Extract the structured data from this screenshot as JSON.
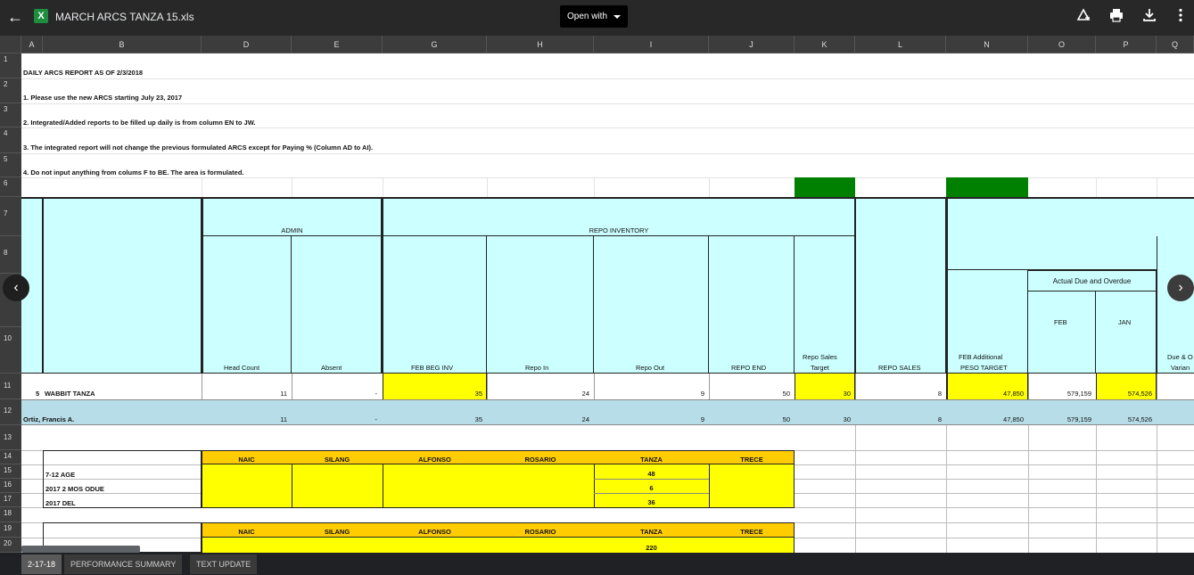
{
  "topbar": {
    "file_title": "MARCH ARCS TANZA 15.xls",
    "file_badge": "X",
    "open_with_label": "Open with",
    "icons": [
      "back-arrow-icon",
      "add-to-drive-icon",
      "print-icon",
      "download-icon",
      "more-vert-icon"
    ]
  },
  "columns": [
    "A",
    "B",
    "D",
    "E",
    "G",
    "H",
    "I",
    "J",
    "K",
    "L",
    "N",
    "O",
    "P",
    "Q"
  ],
  "rows": [
    "1",
    "2",
    "3",
    "4",
    "5",
    "6",
    "7",
    "8",
    "",
    "10",
    "11",
    "12",
    "13",
    "14",
    "15",
    "16",
    "17",
    "18",
    "19",
    "20"
  ],
  "notes": {
    "r1": "DAILY ARCS REPORT AS OF   2/3/2018",
    "r2": "1. Please use the new ARCS starting July 23, 2017",
    "r3": "2. Integrated/Added reports to be filled up daily is from column  EN to JW.",
    "r4": "3. The integrated report will not change the previous formulated ARCS    except for Paying % (Column AD to AI).",
    "r5": "4. Do not input anything from colums F to BE. The area is formulated."
  },
  "header": {
    "admin": "ADMIN",
    "repo_inventory": "REPO INVENTORY",
    "actual_due": "Actual Due and Overdue",
    "feb": "FEB",
    "jan": "JAN",
    "head_count": "Head Count",
    "absent": "Absent",
    "feb_beg_inv": "FEB BEG INV",
    "repo_in": "Repo In",
    "repo_out": "Repo Out",
    "repo_end": "REPO END",
    "repo_sales_target_1": "Repo Sales",
    "repo_sales_target_2": "Target",
    "repo_sales": "REPO SALES",
    "feb_add_1": "FEB Additional",
    "feb_add_2": "PESO TARGET",
    "due_var_1": "Due & O",
    "due_var_2": "Varian"
  },
  "row11": {
    "a": "5",
    "b": "WABBIT TANZA",
    "head_count": "11",
    "absent": "-",
    "feb_beg_inv": "35",
    "repo_in": "24",
    "repo_out": "9",
    "repo_end": "50",
    "repo_sales_target": "30",
    "repo_sales": "8",
    "feb_add": "47,850",
    "feb": "579,159",
    "jan": "574,526"
  },
  "row12": {
    "b": "Ortiz, Francis A.",
    "head_count": "11",
    "absent": "-",
    "feb_beg_inv": "35",
    "repo_in": "24",
    "repo_out": "9",
    "repo_end": "50",
    "repo_sales_target": "30",
    "repo_sales": "8",
    "feb_add": "47,850",
    "feb": "579,159",
    "jan": "574,526"
  },
  "branches": [
    "NAIC",
    "SILANG",
    "ALFONSO",
    "ROSARIO",
    "TANZA",
    "TRECE"
  ],
  "block1": {
    "labels": [
      "7-12 AGE",
      "2017 2 MOS ODUE",
      "2017 DEL"
    ],
    "tanza": [
      "48",
      "6",
      "36"
    ]
  },
  "block2": {
    "tanza_first": "220"
  },
  "tabs": [
    "2-17-18",
    "PERFORMANCE SUMMARY",
    "TEXT UPDATE"
  ]
}
